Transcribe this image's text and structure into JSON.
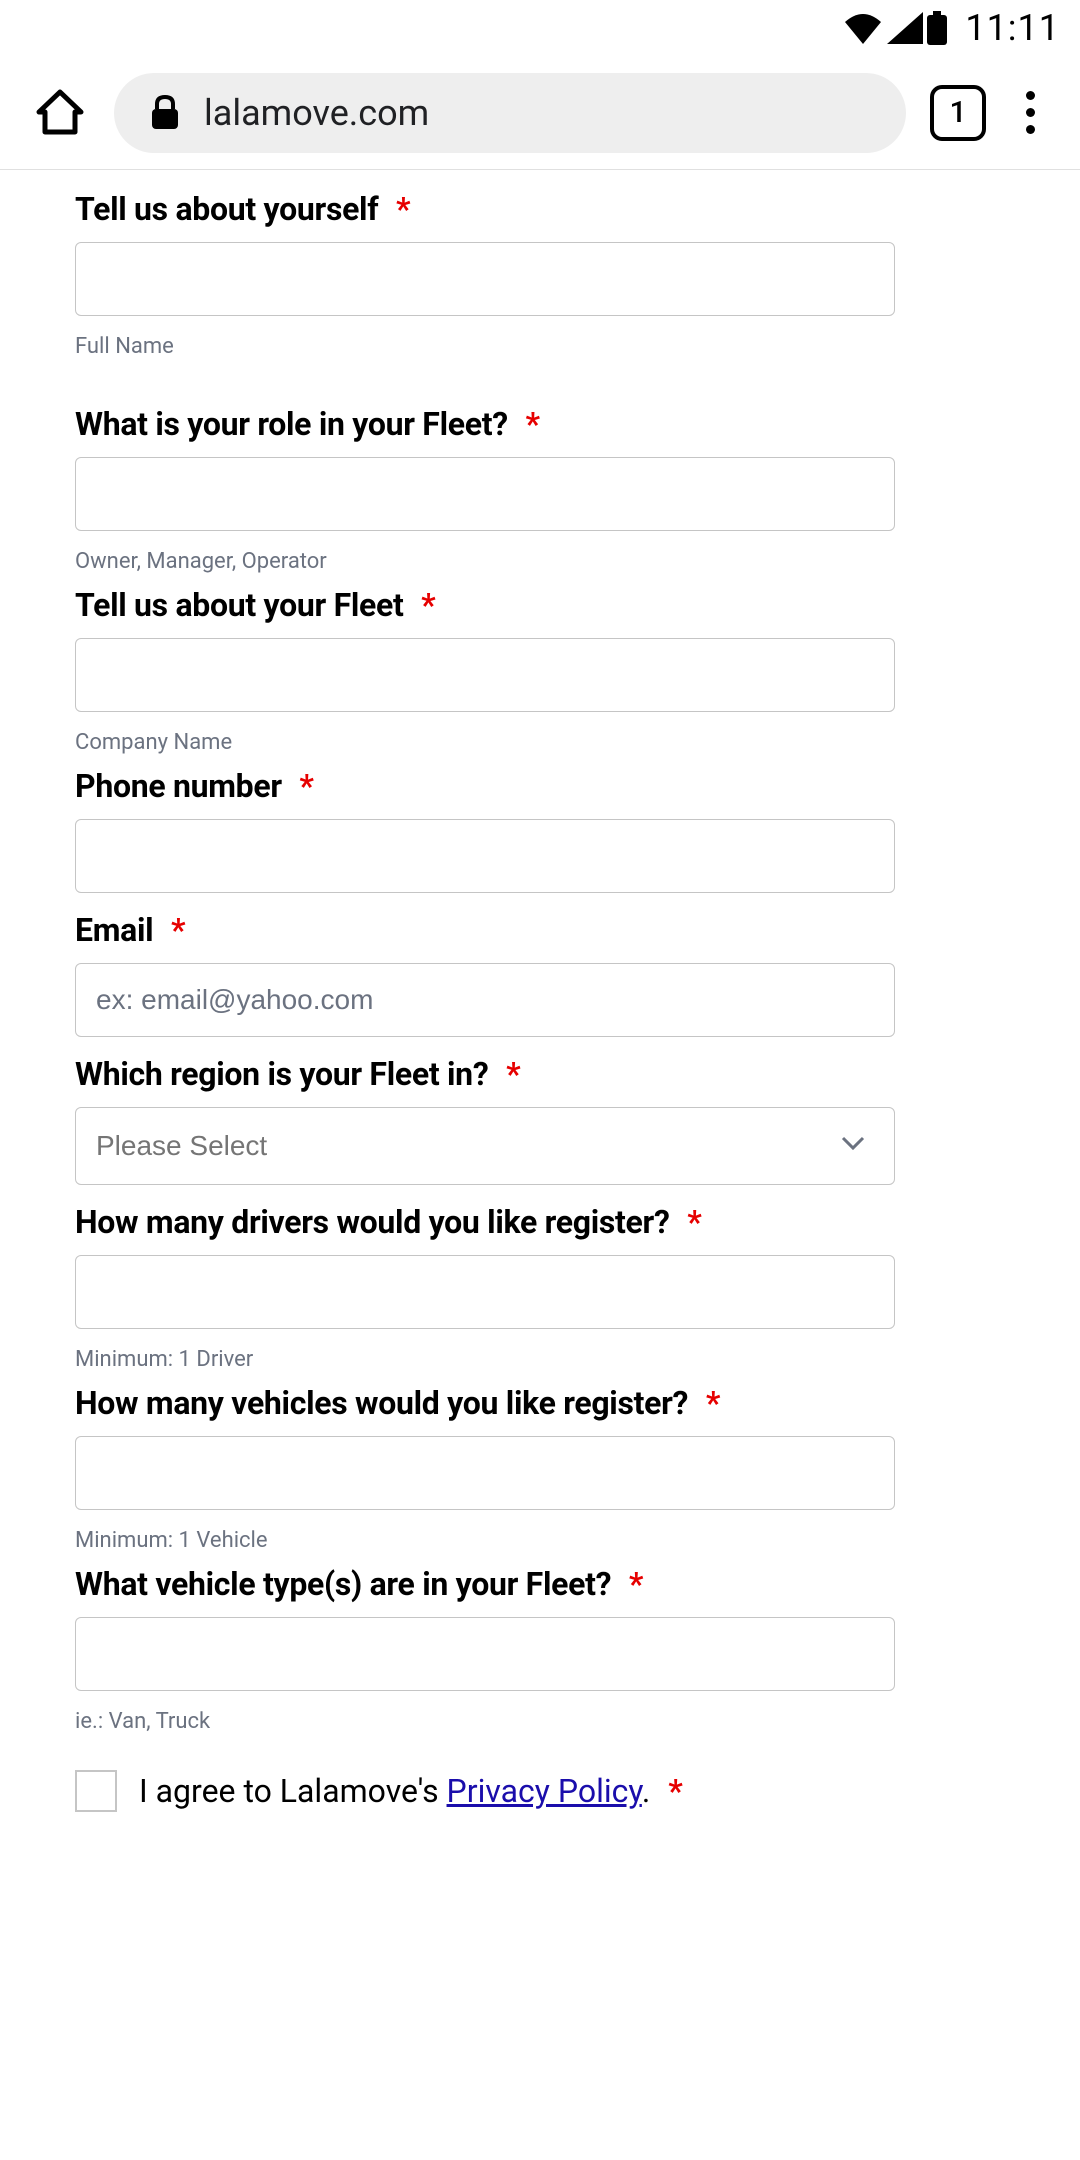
{
  "statusBar": {
    "time": "11:11"
  },
  "browser": {
    "url": "lalamove.com",
    "tabCount": "1"
  },
  "form": {
    "name": {
      "label": "Tell us about yourself",
      "sublabel": "Full Name"
    },
    "role": {
      "label": "What is your role in your Fleet?",
      "sublabel": "Owner, Manager, Operator"
    },
    "fleet": {
      "label": "Tell us about your Fleet",
      "sublabel": "Company Name"
    },
    "phone": {
      "label": "Phone number"
    },
    "email": {
      "label": "Email",
      "placeholder": "ex: email@yahoo.com"
    },
    "region": {
      "label": "Which region is your Fleet in?",
      "placeholder": "Please Select"
    },
    "drivers": {
      "label": "How many drivers would you like register?",
      "sublabel": "Minimum: 1 Driver"
    },
    "vehicles": {
      "label": "How many vehicles would you like register?",
      "sublabel": "Minimum: 1 Vehicle"
    },
    "vehicleType": {
      "label": "What vehicle type(s) are in your Fleet?",
      "sublabel": "ie.: Van, Truck"
    },
    "privacy": {
      "prefix": "I agree to Lalamove's ",
      "linkText": "Privacy Policy",
      "suffix": "."
    },
    "requiredMark": "*"
  }
}
